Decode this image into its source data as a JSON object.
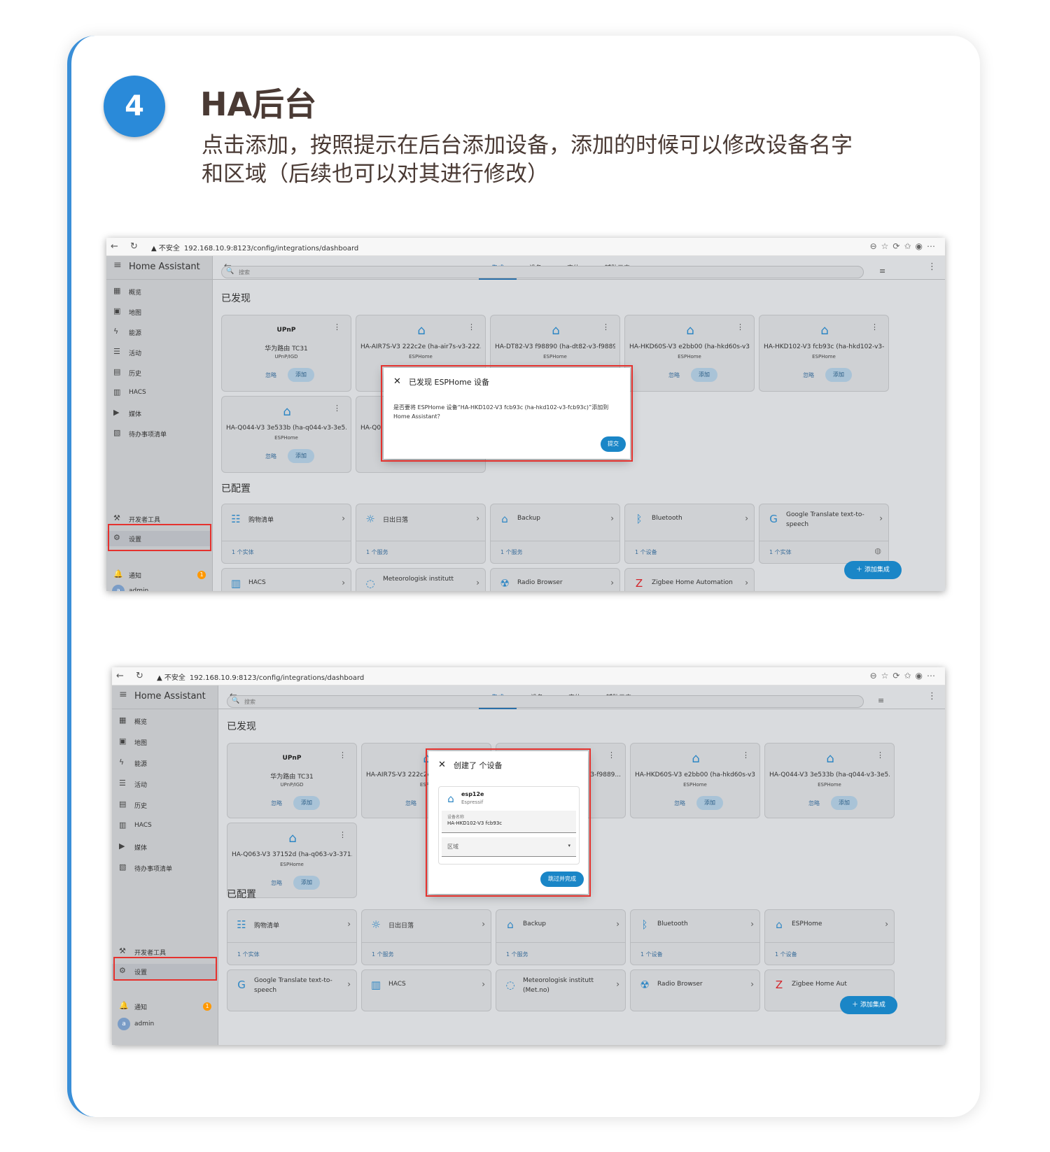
{
  "step": {
    "number": "4",
    "title": "HA后台"
  },
  "description": {
    "line1": "点击添加，按照提示在后台添加设备，添加的时候可以修改设备名字",
    "line2": "和区域（后续也可以对其进行修改）"
  },
  "colors": {
    "accent": "#2a8ad9",
    "highlight": "#e5322e",
    "ha_blue": "#1a86c7"
  },
  "browser": {
    "insecure": "不安全",
    "url": "192.168.10.9:8123/config/integrations/dashboard"
  },
  "app": {
    "title": "Home Assistant"
  },
  "sidebar": {
    "items": [
      {
        "icon": "dashboard-icon",
        "label": "概览"
      },
      {
        "icon": "map-icon",
        "label": "地图"
      },
      {
        "icon": "energy-icon",
        "label": "能源"
      },
      {
        "icon": "logbook-icon",
        "label": "活动"
      },
      {
        "icon": "history-icon",
        "label": "历史"
      },
      {
        "icon": "hacs-icon",
        "label": "HACS"
      },
      {
        "icon": "media-icon",
        "label": "媒体"
      },
      {
        "icon": "todo-icon",
        "label": "待办事项清单"
      }
    ],
    "dev_tools": "开发者工具",
    "settings": "设置",
    "notifications": "通知",
    "notification_count": "1",
    "user": "admin",
    "user_initial": "a"
  },
  "tabs": [
    "集成",
    "设备",
    "实体",
    "辅助元素"
  ],
  "search_placeholder": "搜索",
  "sections": {
    "discovered": "已发现",
    "configured": "已配置"
  },
  "common": {
    "ignore": "忽略",
    "add": "添加",
    "add_integration": "添加集成",
    "esphome": "ESPHome",
    "upnp": "UPnP"
  },
  "screen1": {
    "discovered": [
      {
        "name": "华为路由 TC31",
        "sub": "UPnP/IGD"
      },
      {
        "name": "HA-AIR7S-V3 222c2e (ha-air7s-v3-222...",
        "sub": "ESPHome"
      },
      {
        "name": "HA-DT82-V3 f98890 (ha-dt82-v3-f9889...",
        "sub": "ESPHome"
      },
      {
        "name": "HA-HKD60S-V3 e2bb00 (ha-hkd60s-v3...",
        "sub": "ESPHome"
      },
      {
        "name": "HA-HKD102-V3 fcb93c (ha-hkd102-v3-...",
        "sub": "ESPHome"
      },
      {
        "name": "HA-Q044-V3 3e533b (ha-q044-v3-3e5...",
        "sub": "ESPHome"
      },
      {
        "name": "HA-Q0",
        "sub": ""
      }
    ],
    "configured_row1": [
      {
        "name": "购物清单",
        "foot": "1 个实体"
      },
      {
        "name": "日出日落",
        "foot": "1 个服务"
      },
      {
        "name": "Backup",
        "foot": "1 个服务"
      },
      {
        "name": "Bluetooth",
        "foot": "1 个设备"
      },
      {
        "name": "Google Translate text-to-",
        "name2": "speech",
        "foot": "1 个实体"
      }
    ],
    "configured_row2": [
      {
        "name": "HACS"
      },
      {
        "name": "Meteorologisk institutt"
      },
      {
        "name": "Radio Browser"
      },
      {
        "name": "Zigbee Home Automation"
      }
    ],
    "dialog": {
      "title": "已发现 ESPHome 设备",
      "body1": "是否要将 ESPHome 设备“HA-HKD102-V3 fcb93c (ha-hkd102-v3-fcb93c)”添加到",
      "body2": "Home Assistant？",
      "submit": "提交"
    }
  },
  "screen2": {
    "discovered": [
      {
        "name": "华为路由 TC31",
        "sub": "UPnP/IGD"
      },
      {
        "name": "HA-AIR7S-V3 222c2e",
        "sub": "ESPH"
      },
      {
        "name": "3-f9889...",
        "sub": ""
      },
      {
        "name": "HA-HKD60S-V3 e2bb00 (ha-hkd60s-v3...",
        "sub": "ESPHome"
      },
      {
        "name": "HA-Q044-V3 3e533b (ha-q044-v3-3e5...",
        "sub": "ESPHome"
      },
      {
        "name": "HA-Q063-V3 37152d (ha-q063-v3-371...",
        "sub": "ESPHome"
      }
    ],
    "configured_row1": [
      {
        "name": "购物清单",
        "foot": "1 个实体"
      },
      {
        "name": "日出日落",
        "foot": "1 个服务"
      },
      {
        "name": "Backup",
        "foot": "1 个服务"
      },
      {
        "name": "Bluetooth",
        "foot": "1 个设备"
      },
      {
        "name": "ESPHome",
        "foot": "1 个设备"
      }
    ],
    "configured_row2": [
      {
        "name": "Google Translate text-to-",
        "name2": "speech"
      },
      {
        "name": "HACS"
      },
      {
        "name": "Meteorologisk institutt",
        "name2": "(Met.no)"
      },
      {
        "name": "Radio Browser"
      },
      {
        "name": "Zigbee Home Aut"
      }
    ],
    "dialog": {
      "title": "创建了 个设备",
      "device_name": "esp12e",
      "manufacturer": "Espressif",
      "name_label": "设备名称",
      "name_value": "HA-HKD102-V3 fcb93c",
      "area_placeholder": "区域",
      "finish": "跳过并完成"
    }
  }
}
